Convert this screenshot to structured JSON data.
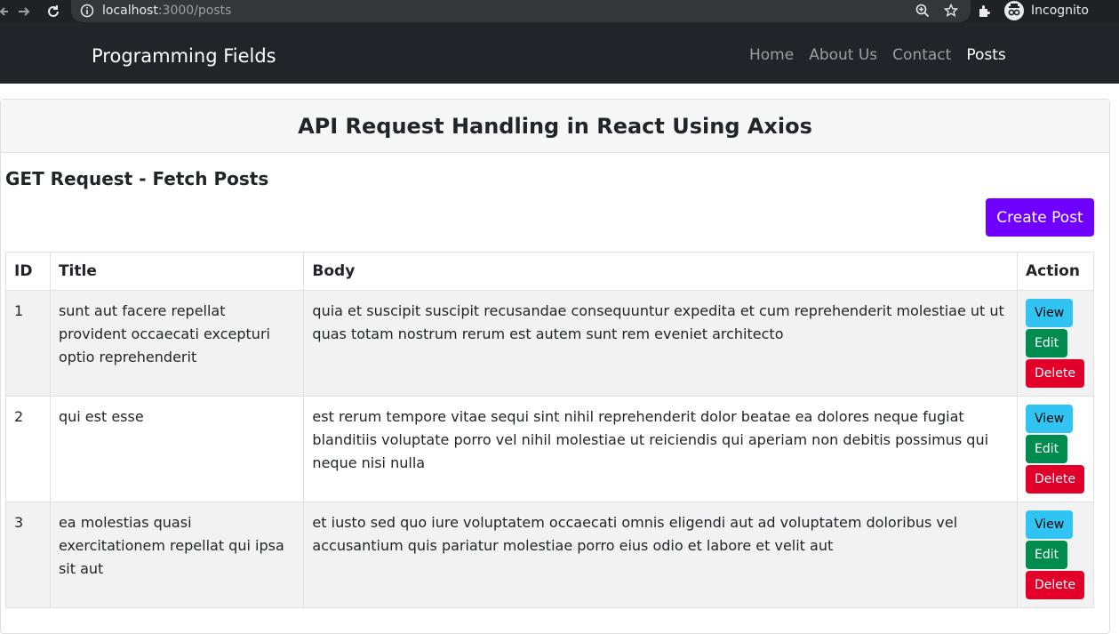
{
  "browser": {
    "url_host": "localhost",
    "url_path": ":3000/posts",
    "profile_label": "Incognito"
  },
  "navbar": {
    "brand": "Programming Fields",
    "links": [
      {
        "label": "Home",
        "active": false
      },
      {
        "label": "About Us",
        "active": false
      },
      {
        "label": "Contact",
        "active": false
      },
      {
        "label": "Posts",
        "active": true
      }
    ]
  },
  "card": {
    "title": "API Request Handling in React Using Axios",
    "section_title": "GET Request - Fetch Posts",
    "create_button": "Create Post"
  },
  "table": {
    "headers": {
      "id": "ID",
      "title": "Title",
      "body": "Body",
      "action": "Action"
    },
    "rows": [
      {
        "id": "1",
        "title": "sunt aut facere repellat provident occaecati excepturi optio reprehenderit",
        "body": "quia et suscipit suscipit recusandae consequuntur expedita et cum reprehenderit molestiae ut ut quas totam nostrum rerum est autem sunt rem eveniet architecto"
      },
      {
        "id": "2",
        "title": "qui est esse",
        "body": "est rerum tempore vitae sequi sint nihil reprehenderit dolor beatae ea dolores neque fugiat blanditiis voluptate porro vel nihil molestiae ut reiciendis qui aperiam non debitis possimus qui neque nisi nulla"
      },
      {
        "id": "3",
        "title": "ea molestias quasi exercitationem repellat qui ipsa sit aut",
        "body": "et iusto sed quo iure voluptatem occaecati omnis eligendi aut ad voluptatem doloribus vel accusantium quis pariatur molestiae porro eius odio et labore et velit aut"
      }
    ],
    "actions": {
      "view": "View",
      "edit": "Edit",
      "delete": "Delete"
    }
  },
  "colors": {
    "navbar_bg": "#212529",
    "create_button": "#6f00ff",
    "view_button": "#31c4f3",
    "edit_button": "#008c4f",
    "delete_button": "#e2002b"
  }
}
